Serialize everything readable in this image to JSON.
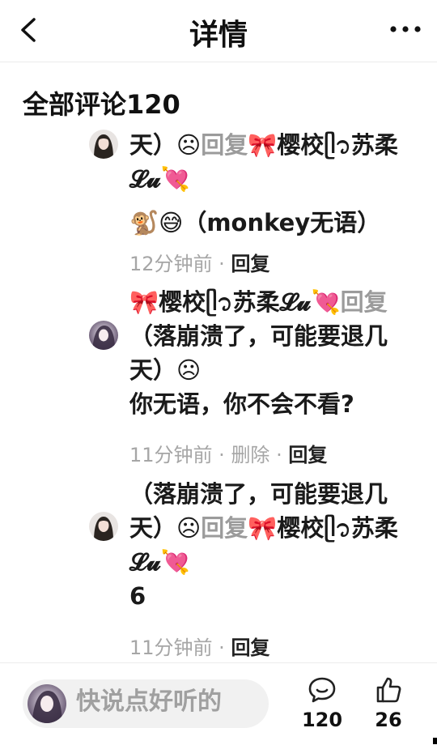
{
  "header": {
    "title": "详情",
    "back_icon": "chevron-left-icon",
    "more_icon": "more-horizontal-icon"
  },
  "section": {
    "title": "全部评论120"
  },
  "comments": [
    {
      "line1": "天）☹",
      "reply_word": "回复",
      "target_user": "🎀樱校ᥫ᭡苏柔",
      "target_suffix": "𝓛𝓾💘",
      "body": "🐒😅（monkey无语）",
      "time": "12分钟前",
      "actions": [
        "回复"
      ]
    },
    {
      "prefix_user": "🎀樱校ᥫ᭡苏柔𝓛𝓾💘",
      "reply_word": "回复",
      "quoted": "（落崩溃了，可能要退几",
      "quoted_line2": "天）☹",
      "body": "你无语，你不会不看?",
      "time": "11分钟前",
      "actions": [
        "删除",
        "回复"
      ]
    },
    {
      "quoted": "（落崩溃了，可能要退几",
      "quoted_line2": "天）☹",
      "reply_word": "回复",
      "target_user": "🎀樱校ᥫ᭡苏柔",
      "target_suffix": "𝓛𝓾💘",
      "body": "6",
      "time": "11分钟前",
      "actions": [
        "回复"
      ]
    }
  ],
  "footer": {
    "input_placeholder": "快说点好听的",
    "comment_count": "120",
    "like_count": "26",
    "comment_icon": "comment-bubble-icon",
    "like_icon": "thumbs-up-icon"
  }
}
